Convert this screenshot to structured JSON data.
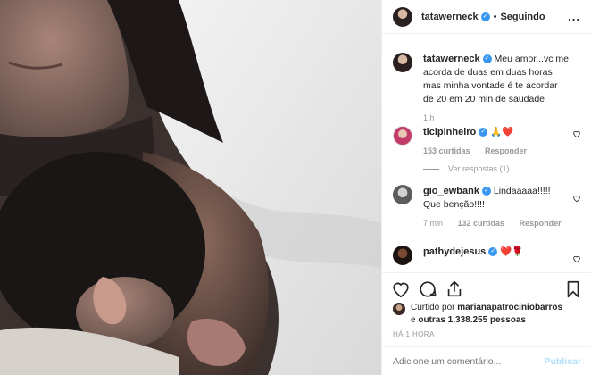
{
  "header": {
    "username": "tatawerneck",
    "separator": "•",
    "follow_state": "Seguindo",
    "more": "..."
  },
  "caption": {
    "username": "tatawerneck",
    "text": "Meu amor...vc me acorda de duas em duas horas mas minha vontade é te acordar de 20 em 20 min de saudade",
    "time": "1 h"
  },
  "comments": [
    {
      "username": "ticipinheiro",
      "text": "🙏❤️",
      "time": "",
      "likes": "153 curtidas",
      "reply": "Responder",
      "view_replies": "Ver respostas (1)"
    },
    {
      "username": "gio_ewbank",
      "text": "Lindaaaaa!!!!! Que benção!!!!",
      "time": "7 min",
      "likes": "132 curtidas",
      "reply": "Responder"
    },
    {
      "username": "pathydejesus",
      "text": "❤️🌹"
    }
  ],
  "likes": {
    "prefix": "Curtido por",
    "first_user": "marianapatrociniobarros",
    "connector": "e",
    "others": "outras 1.338.255 pessoas"
  },
  "posted": "HÁ 1 HORA",
  "comment_box": {
    "placeholder": "Adicione um comentário...",
    "publish": "Publicar"
  },
  "colors": {
    "verified": "#3897f0",
    "publish_disabled": "#b2dffc",
    "meta_text": "#999999"
  }
}
